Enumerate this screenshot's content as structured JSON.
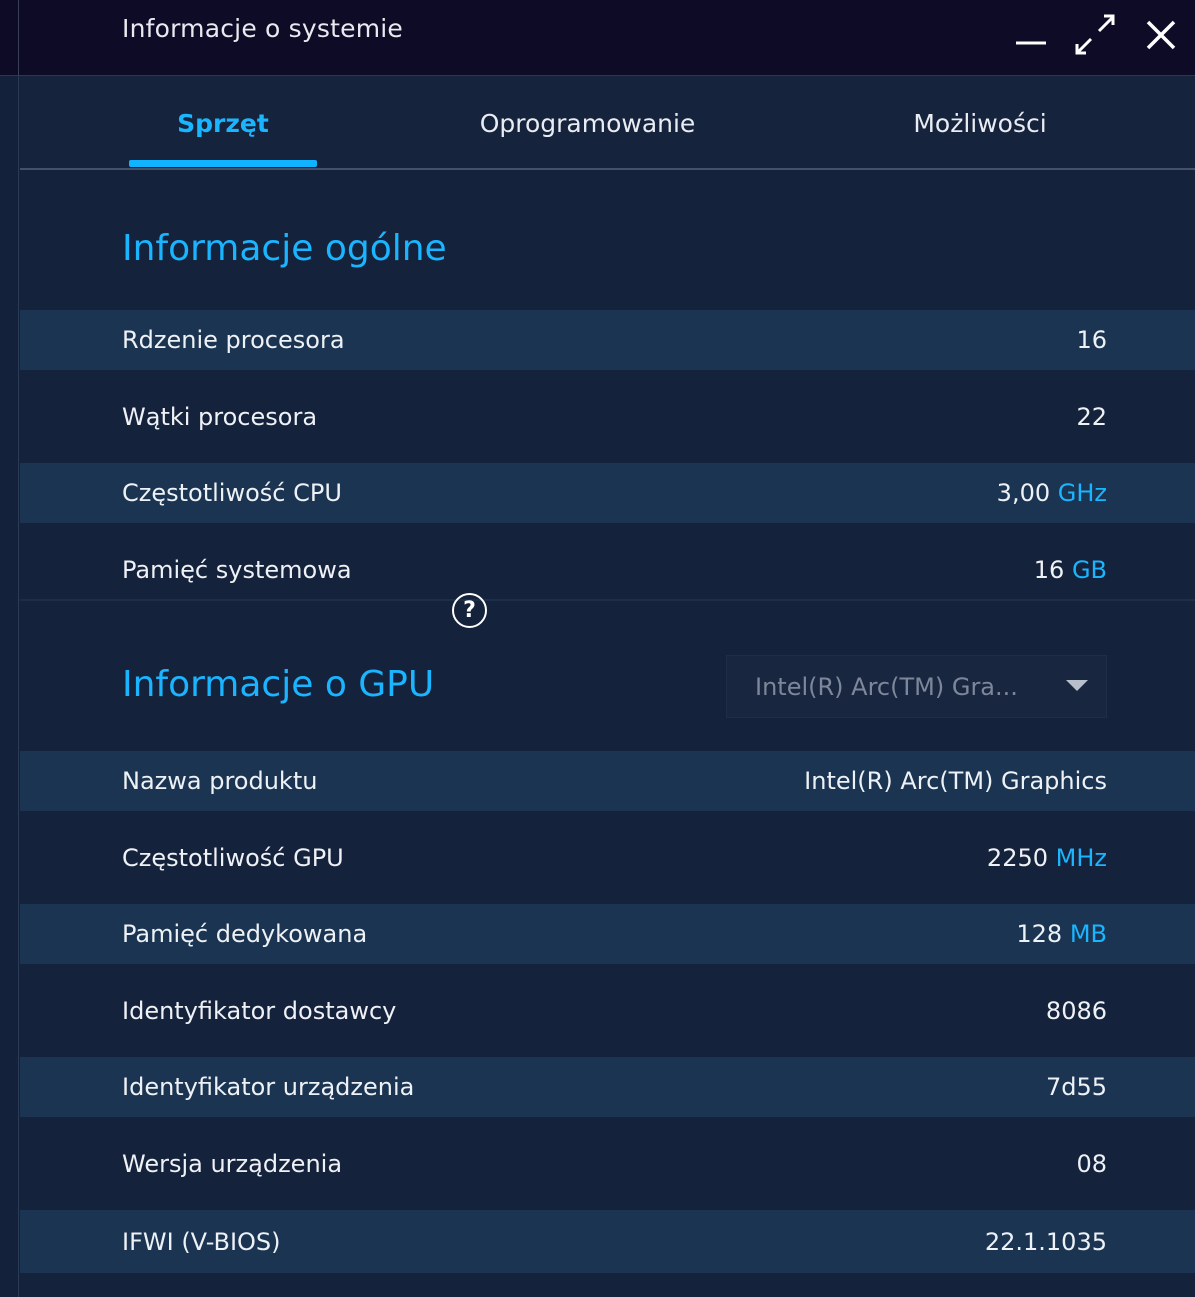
{
  "window": {
    "title": "Informacje o systemie",
    "minimize_icon": "minimize-icon",
    "maximize_icon": "expand-arrows-icon",
    "close_icon": "close-icon"
  },
  "tabs": [
    {
      "label": "Sprzęt",
      "active": true
    },
    {
      "label": "Oprogramowanie",
      "active": false
    },
    {
      "label": "Możliwości",
      "active": false
    }
  ],
  "general": {
    "title": "Informacje ogólne",
    "rows": [
      {
        "label": "Rdzenie procesora",
        "value": "16",
        "unit": ""
      },
      {
        "label": "Wątki procesora",
        "value": "22",
        "unit": ""
      },
      {
        "label": "Częstotliwość CPU",
        "value": "3,00",
        "unit": "GHz"
      },
      {
        "label": "Pamięć systemowa",
        "value": "16",
        "unit": "GB"
      }
    ]
  },
  "gpu": {
    "title": "Informacje o GPU",
    "help": "?",
    "selected_gpu": "Intel(R) Arc(TM) Gra...",
    "rows": [
      {
        "label": "Nazwa produktu",
        "value": "Intel(R) Arc(TM) Graphics",
        "unit": ""
      },
      {
        "label": "Częstotliwość GPU",
        "value": "2250",
        "unit": "MHz"
      },
      {
        "label": "Pamięć dedykowana",
        "value": "128",
        "unit": "MB"
      },
      {
        "label": "Identyfikator dostawcy",
        "value": "8086",
        "unit": ""
      },
      {
        "label": "Identyfikator urządzenia",
        "value": "7d55",
        "unit": ""
      },
      {
        "label": "Wersja urządzenia",
        "value": "08",
        "unit": ""
      },
      {
        "label": "IFWI (V-BIOS)",
        "value": "22.1.1035",
        "unit": ""
      }
    ]
  },
  "colors": {
    "accent": "#1ab4ff",
    "titlebar": "#0e0b26",
    "row_alt": "#1a3452",
    "background": "#15223b"
  }
}
